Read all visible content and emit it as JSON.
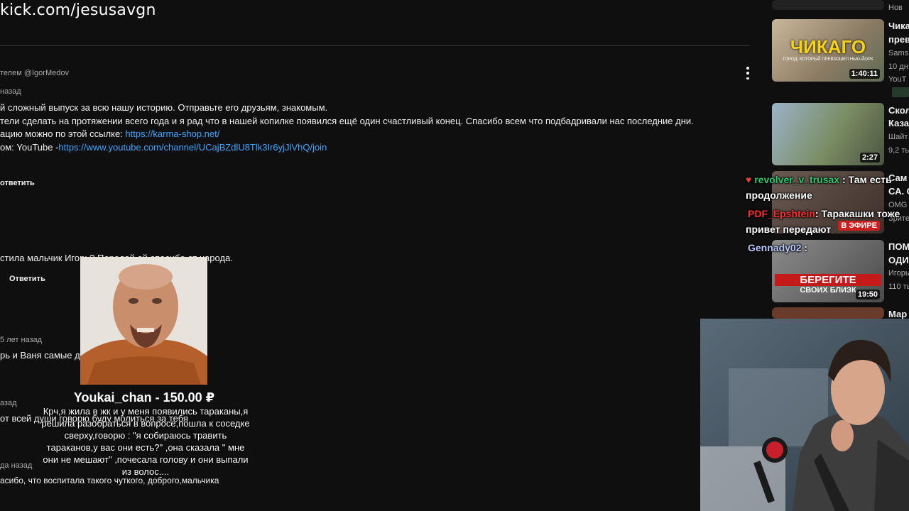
{
  "overlay": {
    "watermark": "kick.com/jesusavgn"
  },
  "comments_header": {
    "author": "телем @IgorMedov",
    "time": "назад",
    "lines": [
      "й сложный выпуск за всю нашу историю. Отправьте его друзьям, знакомым.",
      "тели сделать на протяжении всего года и я рад что в нашей копилке появился ещё один счастливый конец. Спасибо всем что подбадривали нас последние дни.",
      "ацию можно по этой ссылке: ",
      "ом: YouTube -"
    ],
    "link1": "https://karma-shop.net/",
    "link2": "https://www.youtube.com/channel/UCajBZdlU8Tlk3Ir6yjJlVhQ/join",
    "reply": "ответить"
  },
  "comments": [
    {
      "text": "стила мальчик Игорь? Передай ей спасибо от народа.",
      "reply": "Ответить"
    },
    {
      "time": "5 лет назад",
      "text": "рь и Ваня самые до"
    },
    {
      "time": "азад",
      "text": "от всей души говорю буду молиться за тебя"
    },
    {
      "time": "да назад",
      "text": "асибо, что воспитала такого чуткого, доброго,мальчика"
    }
  ],
  "donation": {
    "name": "Youkai_chan - 150.00 ₽",
    "message": "Крч,я жила в жк и у меня появились тараканы,я решила разобраться в вопросе,пошла к соседке сверху,говорю : \"я собираюсь травить тараканов,у вас они есть?\" ,она сказала \" мне они не мешают\" ,почесала голову и они выпали из волос...."
  },
  "sidebar": {
    "top_label": "Нов",
    "items": [
      {
        "title1": "Чика",
        "title2": "прев",
        "meta1": "Sams",
        "meta2": "10 дн",
        "meta3": "YouT",
        "thumb_text": "ЧИКАГО",
        "thumb_sub": "ГОРОД, КОТОРЫЙ ПРЕВЗОШЕЛ НЬЮ-ЙОРК",
        "duration": "1:40:11"
      },
      {
        "title1": "Скол",
        "title2": "Каза",
        "meta1": "Шайт",
        "meta2": "9,2 ть",
        "duration": "2:27"
      },
      {
        "title1": "Сам",
        "title2": "СА. С",
        "meta1": "ОМG",
        "meta2": "Зрите",
        "live_badge": "В ЭФИРЕ"
      },
      {
        "title1": "ПОМ",
        "title2": "ОДИ",
        "meta1": "Игорь",
        "meta2": "110 ть",
        "thumb_text": "БЕРЕГИТЕ",
        "thumb_sub": "СВОИХ БЛИЗК",
        "duration": "19:50"
      },
      {
        "title1": "Мар"
      }
    ]
  },
  "chat": [
    {
      "user": "revolver_v_trusax",
      "user_color": "#2ecc71",
      "text": " : Там есть",
      "cont": "продолжение"
    },
    {
      "user": "PDF_Epshtein",
      "user_color": "#ff3030",
      "text": ": Таракашки тоже",
      "cont": "привет передают"
    },
    {
      "user": "Gennady02",
      "user_color": "#b8c8ff",
      "text": " :"
    }
  ],
  "colors": {
    "background": "#0f0f0f",
    "link": "#3ea6ff",
    "meta": "#aaaaaa"
  }
}
